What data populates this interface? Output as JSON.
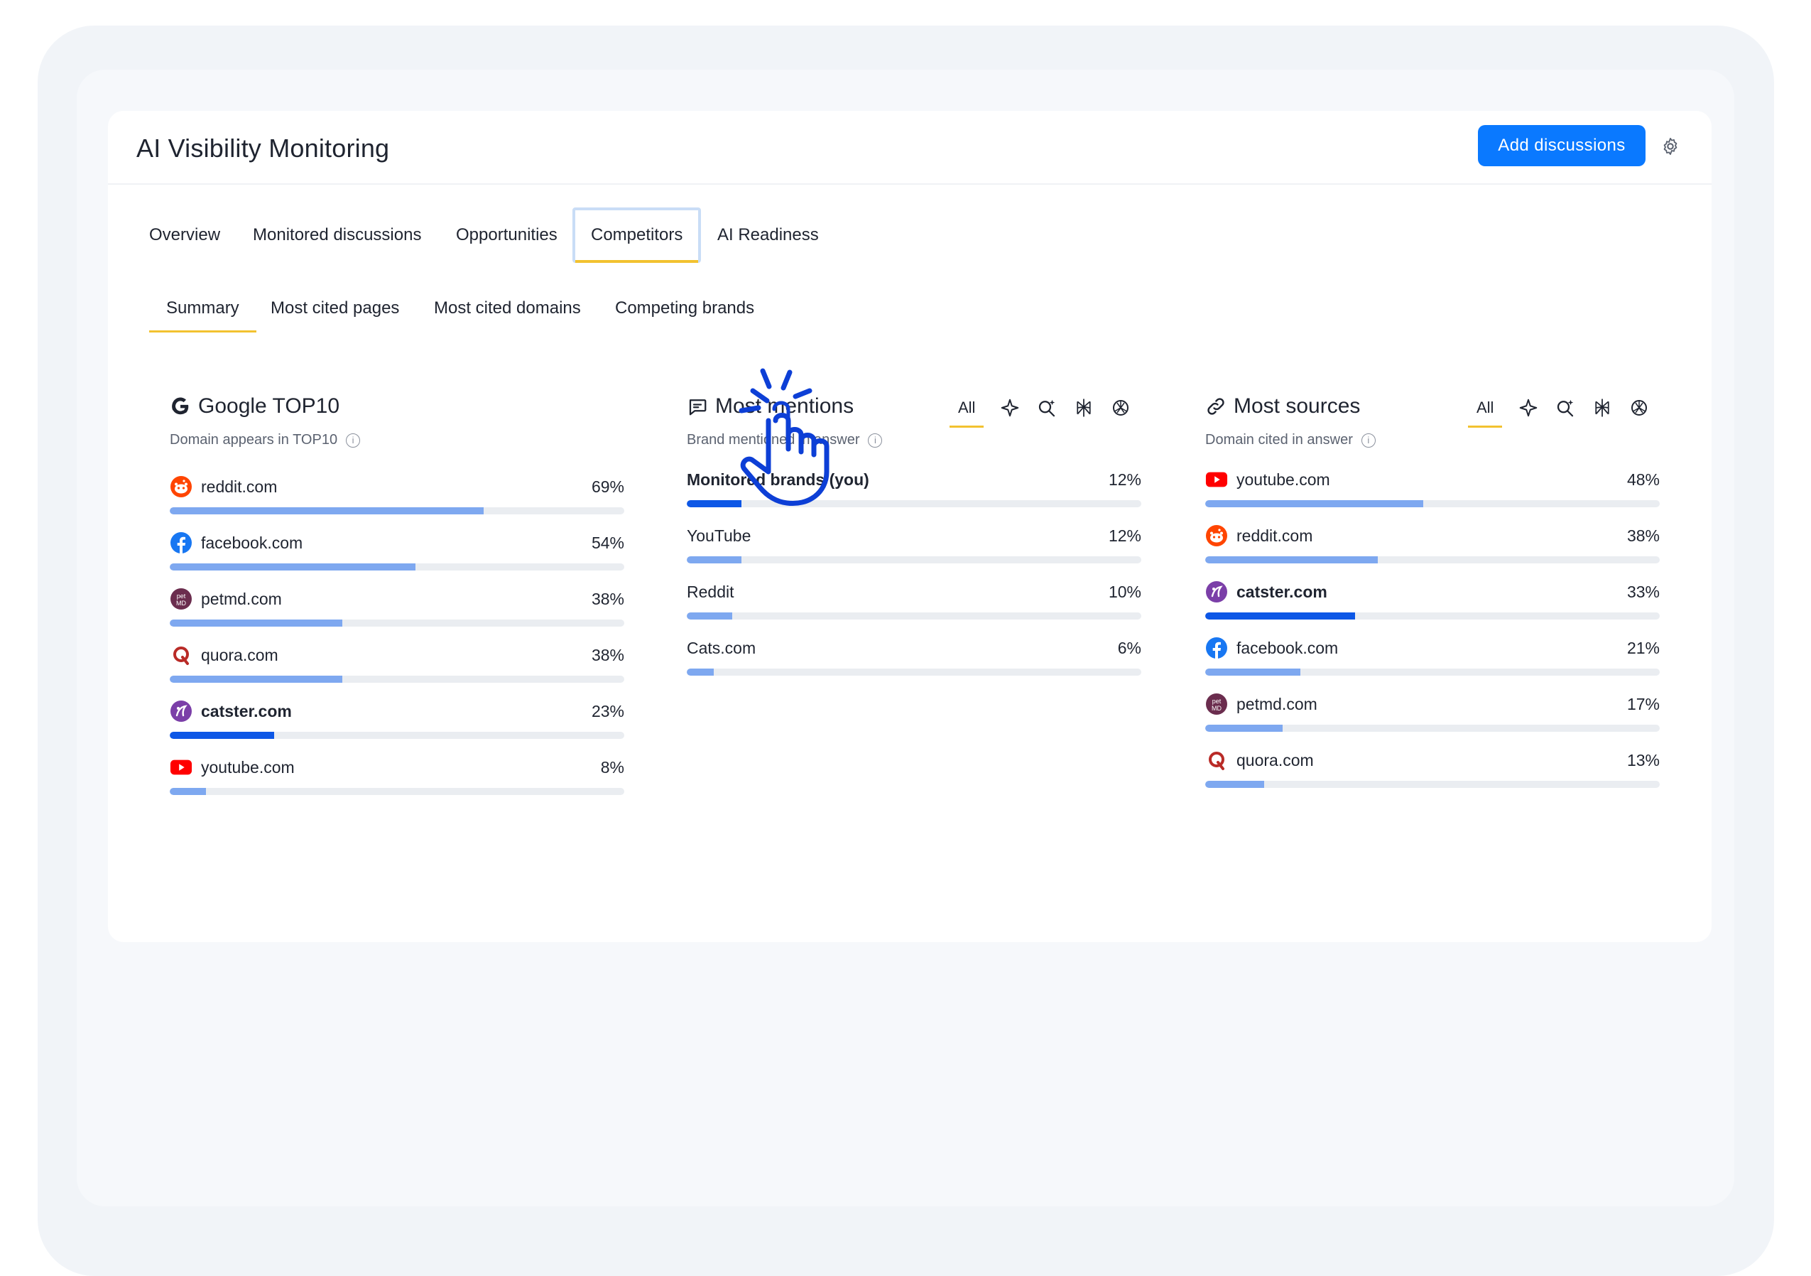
{
  "header": {
    "title": "AI Visibility Monitoring",
    "add_button": "Add discussions"
  },
  "tabs": [
    {
      "label": "Overview"
    },
    {
      "label": "Monitored discussions"
    },
    {
      "label": "Opportunities"
    },
    {
      "label": "Competitors",
      "active": true
    },
    {
      "label": "AI Readiness"
    }
  ],
  "subtabs": [
    {
      "label": "Summary",
      "active": true
    },
    {
      "label": "Most cited pages"
    },
    {
      "label": "Most cited domains"
    },
    {
      "label": "Competing brands"
    }
  ],
  "panels": {
    "google": {
      "title": "Google TOP10",
      "subtitle": "Domain appears in TOP10",
      "rows": [
        {
          "label": "reddit.com",
          "pct": "69%",
          "value": 0.69,
          "icon": "reddit-icon"
        },
        {
          "label": "facebook.com",
          "pct": "54%",
          "value": 0.54,
          "icon": "facebook-icon"
        },
        {
          "label": "petmd.com",
          "pct": "38%",
          "value": 0.38,
          "icon": "petmd-icon"
        },
        {
          "label": "quora.com",
          "pct": "38%",
          "value": 0.38,
          "icon": "quora-icon"
        },
        {
          "label": "catster.com",
          "pct": "23%",
          "value": 0.23,
          "icon": "catster-icon",
          "own": true
        },
        {
          "label": "youtube.com",
          "pct": "8%",
          "value": 0.08,
          "icon": "youtube-icon"
        }
      ]
    },
    "mentions": {
      "title": "Most mentions",
      "subtitle": "Brand mentioned in answer",
      "filter_all": "All",
      "rows": [
        {
          "label": "Monitored brands (you)",
          "pct": "12%",
          "value": 0.12,
          "own": true
        },
        {
          "label": "YouTube",
          "pct": "12%",
          "value": 0.12
        },
        {
          "label": "Reddit",
          "pct": "10%",
          "value": 0.1
        },
        {
          "label": "Cats.com",
          "pct": "6%",
          "value": 0.06
        }
      ]
    },
    "sources": {
      "title": "Most sources",
      "subtitle": "Domain cited in answer",
      "filter_all": "All",
      "rows": [
        {
          "label": "youtube.com",
          "pct": "48%",
          "value": 0.48,
          "icon": "youtube-icon"
        },
        {
          "label": "reddit.com",
          "pct": "38%",
          "value": 0.38,
          "icon": "reddit-icon"
        },
        {
          "label": "catster.com",
          "pct": "33%",
          "value": 0.33,
          "icon": "catster-icon",
          "own": true
        },
        {
          "label": "facebook.com",
          "pct": "21%",
          "value": 0.21,
          "icon": "facebook-icon"
        },
        {
          "label": "petmd.com",
          "pct": "17%",
          "value": 0.17,
          "icon": "petmd-icon"
        },
        {
          "label": "quora.com",
          "pct": "13%",
          "value": 0.13,
          "icon": "quora-icon"
        }
      ]
    }
  },
  "colors": {
    "accent": "#0a79ff",
    "bar": "#7ea8f0",
    "bar_own": "#0d57e6",
    "tab_underline": "#f2c230",
    "hand": "#0d3fd6"
  }
}
